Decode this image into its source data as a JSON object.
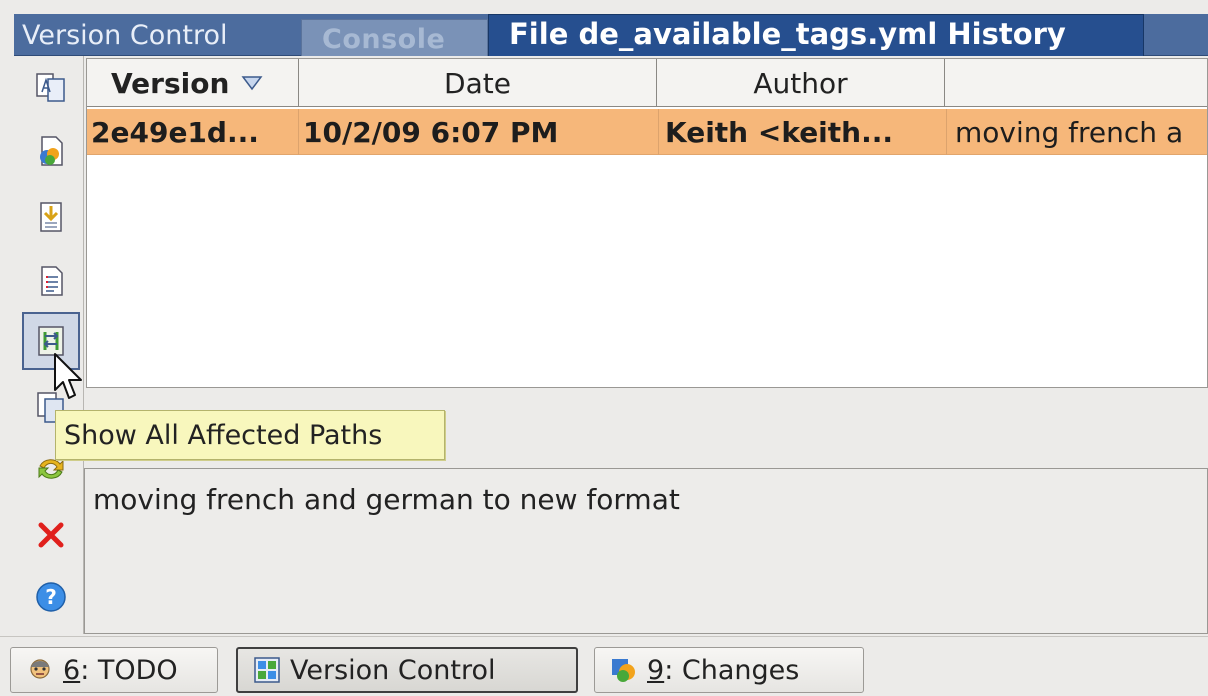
{
  "panel": {
    "title": "Version Control",
    "tabs": [
      {
        "label": "Console",
        "active": false
      },
      {
        "label": "File de_available_tags.yml History",
        "active": true
      }
    ]
  },
  "toolbar": {
    "buttons": [
      {
        "icon": "compare-versions-icon"
      },
      {
        "icon": "annotate-icon"
      },
      {
        "icon": "get-revision-icon"
      },
      {
        "icon": "show-details-icon"
      },
      {
        "icon": "show-all-affected-paths-icon",
        "hover": true
      },
      {
        "icon": "copy-icon"
      },
      {
        "icon": "refresh-icon"
      },
      {
        "icon": "close-icon"
      },
      {
        "icon": "help-icon"
      }
    ]
  },
  "table": {
    "columns": [
      "Version",
      "Date",
      "Author",
      ""
    ],
    "sorted_column": "Version",
    "rows": [
      {
        "version": "2e49e1d...",
        "date": "10/2/09 6:07 PM",
        "author": "Keith <keith...",
        "message": "moving french a"
      }
    ]
  },
  "tooltip": {
    "text": "Show All Affected Paths"
  },
  "details": {
    "message": "moving french and german to new format"
  },
  "statusbar": {
    "todo": {
      "mnemonic": "6",
      "label": ": TODO"
    },
    "vcs": {
      "label": "Version Control"
    },
    "changes": {
      "mnemonic": "9",
      "label": ": Changes"
    }
  },
  "colors": {
    "selected_row": "#f6b77a",
    "active_tab": "#264f8f",
    "title_bar": "#4c6c9e",
    "tooltip_bg": "#f8f7bd"
  }
}
